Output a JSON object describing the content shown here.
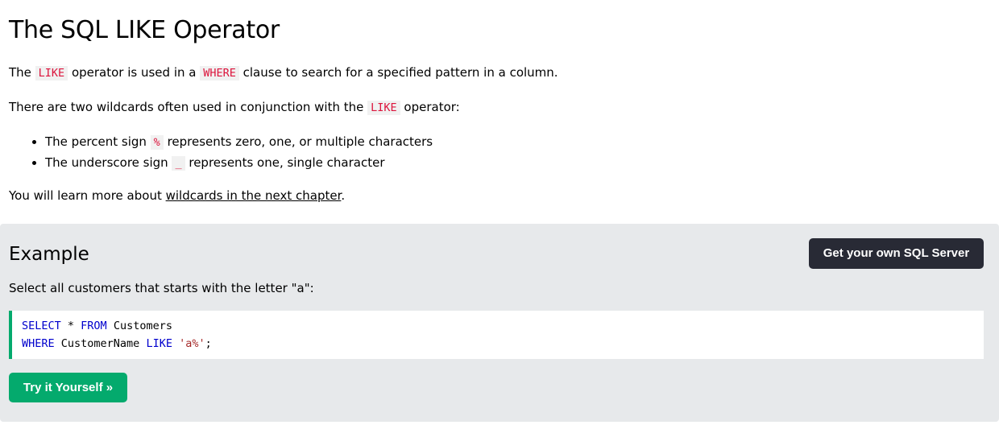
{
  "title": "The SQL LIKE Operator",
  "intro": {
    "p1": [
      "The ",
      "LIKE",
      " operator is used in a ",
      "WHERE",
      " clause to search for a specified pattern in a column."
    ],
    "p2": [
      "There are two wildcards often used in conjunction with the ",
      "LIKE",
      " operator:"
    ]
  },
  "wildcards": [
    {
      "before": "The percent sign ",
      "code": "%",
      "after": " represents zero, one, or multiple characters"
    },
    {
      "before": "The underscore sign ",
      "code": "_",
      "after": " represents one, single character"
    }
  ],
  "learn_more": {
    "before": "You will learn more about ",
    "link": "wildcards in the next chapter",
    "after": "."
  },
  "example": {
    "heading": "Example",
    "server_button": "Get your own SQL Server",
    "description": "Select all customers that starts with the letter \"a\":",
    "code_line1": {
      "kw1": "SELECT",
      "mid": " * ",
      "kw2": "FROM",
      "rest": " Customers"
    },
    "code_line2": {
      "kw1": "WHERE",
      "mid": " CustomerName ",
      "kw2": "LIKE",
      "space": " ",
      "str": "'a%'",
      "end": ";"
    },
    "try_button": "Try it Yourself »"
  },
  "colors": {
    "accent_green": "#04aa6d",
    "dark_button": "#282a35",
    "code_red": "#dc143c",
    "keyword_blue": "#0000cd",
    "string_brown": "#a52a2a",
    "panel_gray": "#e7e9eb"
  }
}
